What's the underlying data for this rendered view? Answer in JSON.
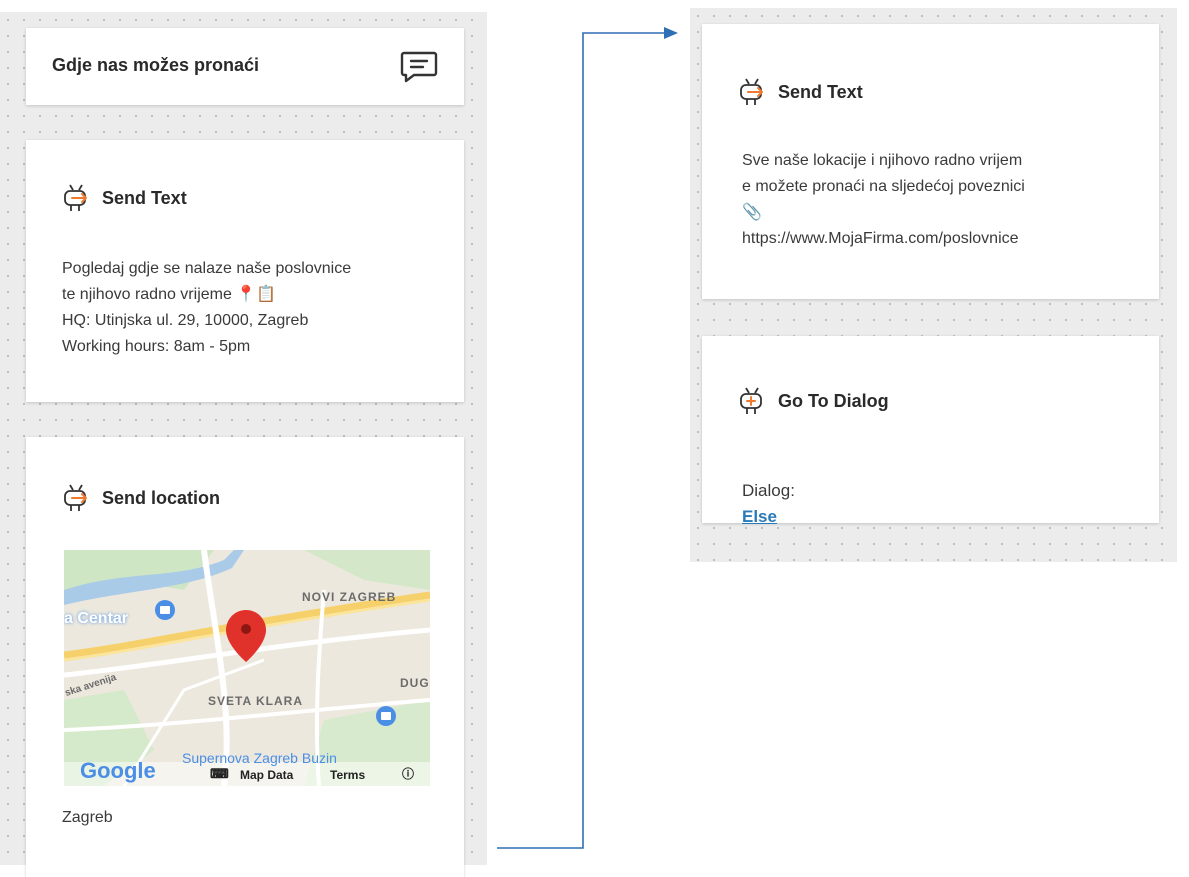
{
  "left_column": {
    "trigger_card": {
      "title": "Gdje nas možes pronaći",
      "icon": "chat-bubble-icon"
    },
    "send_text_card": {
      "title": "Send Text",
      "icon": "robot-icon",
      "text": "Pogledaj gdje se nalaze naše poslovnice\nte njihovo radno vrijeme 📍📋\nHQ: Utinjska ul. 29, 10000, Zagreb\nWorking hours: 8am - 5pm"
    },
    "send_location_card": {
      "title": "Send location",
      "icon": "robot-icon",
      "caption": "Zagreb",
      "map": {
        "labels": [
          "NOVI ZAGREB",
          "a Centar",
          "ska avenija",
          "SVETA KLARA",
          "DUG",
          "Supernova Zagreb Buzin"
        ],
        "footer": {
          "brand": "Google",
          "map_data": "Map Data",
          "terms": "Terms"
        }
      }
    }
  },
  "right_column": {
    "send_text_card": {
      "title": "Send Text",
      "icon": "robot-icon",
      "text": "Sve naše lokacije i njihovo radno vrijem\ne možete pronaći na sljedećoj poveznici\n📎\nhttps://www.MojaFirma.com/poslovnice"
    },
    "go_to_dialog_card": {
      "title": "Go To Dialog",
      "icon": "robot-icon",
      "dialog_label": "Dialog:",
      "dialog_value": "Else"
    }
  },
  "colors": {
    "accent_orange": "#f07a2e",
    "link_blue": "#2a7ab8",
    "connector_blue": "#2e6fb5"
  }
}
